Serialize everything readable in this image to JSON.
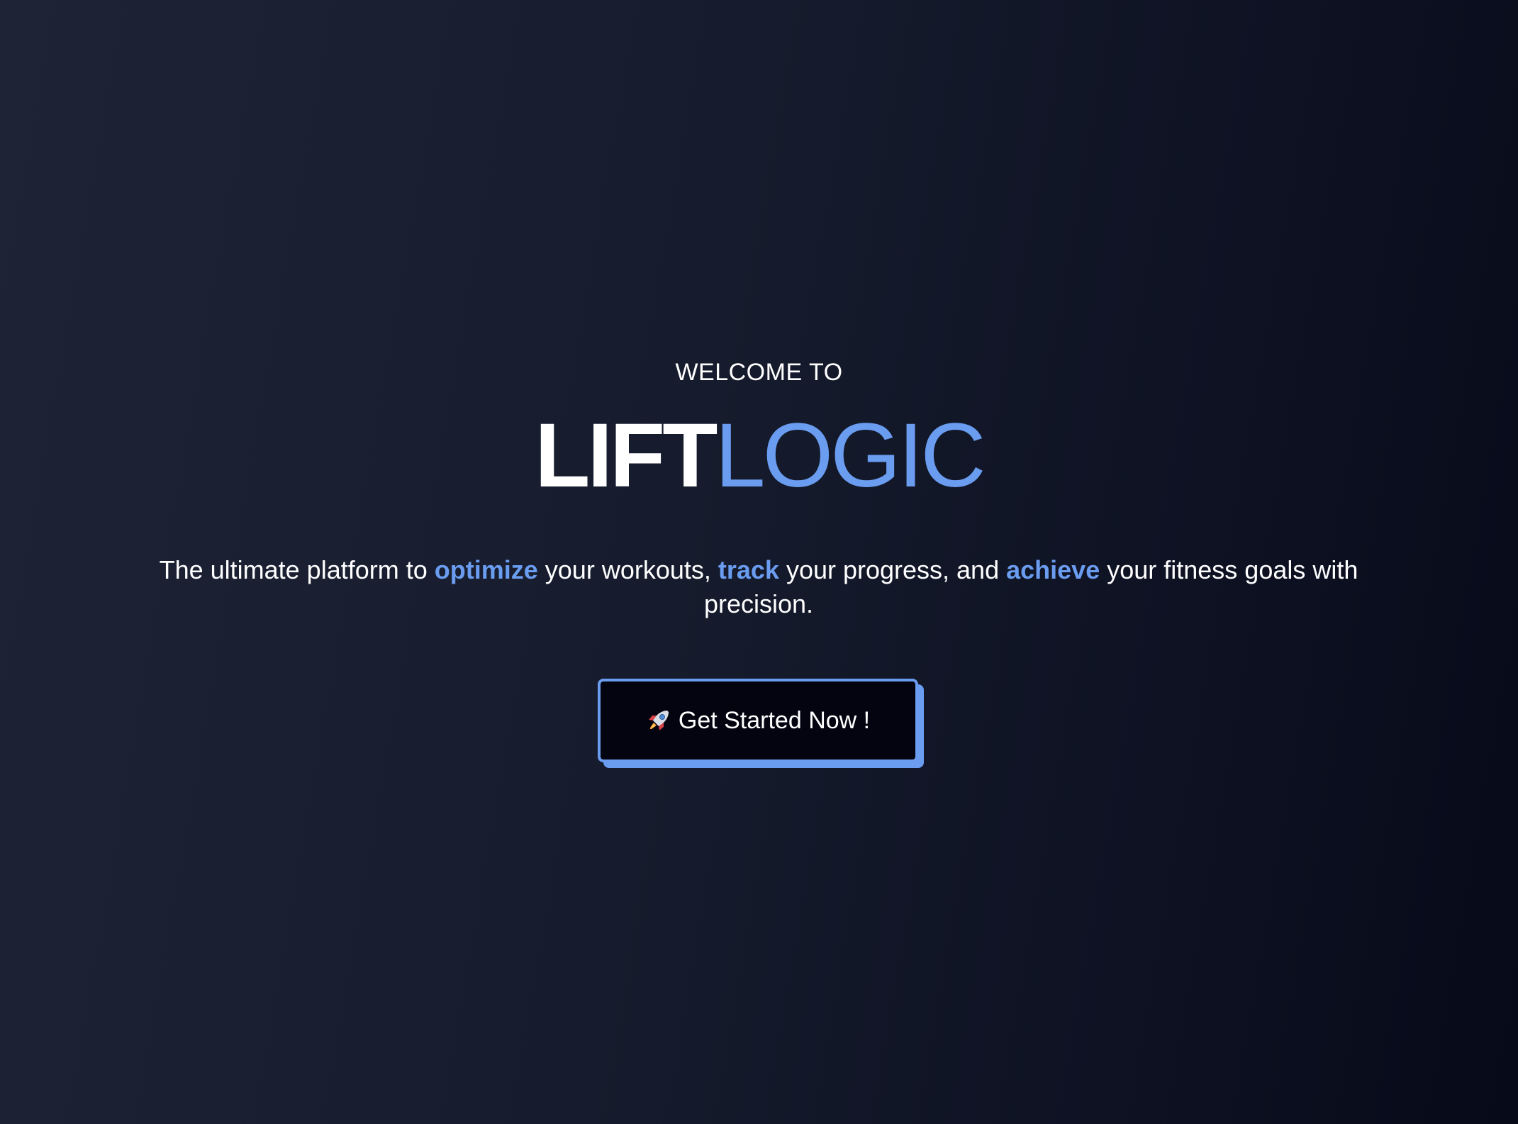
{
  "hero": {
    "welcome": "WELCOME TO",
    "brand_part1": "LIFT",
    "brand_part2": "LOGIC",
    "tagline": {
      "t1": "The ultimate platform to ",
      "h1": "optimize",
      "t2": " your workouts, ",
      "h2": "track",
      "t3": " your progress, and ",
      "h3": "achieve",
      "t4": " your fitness goals with precision."
    },
    "cta": {
      "icon": "rocket-icon",
      "label": "Get Started Now !"
    }
  },
  "colors": {
    "accent": "#6a9cf0",
    "background_start": "#1e2436",
    "background_end": "#070a18",
    "button_bg": "#03040f"
  }
}
